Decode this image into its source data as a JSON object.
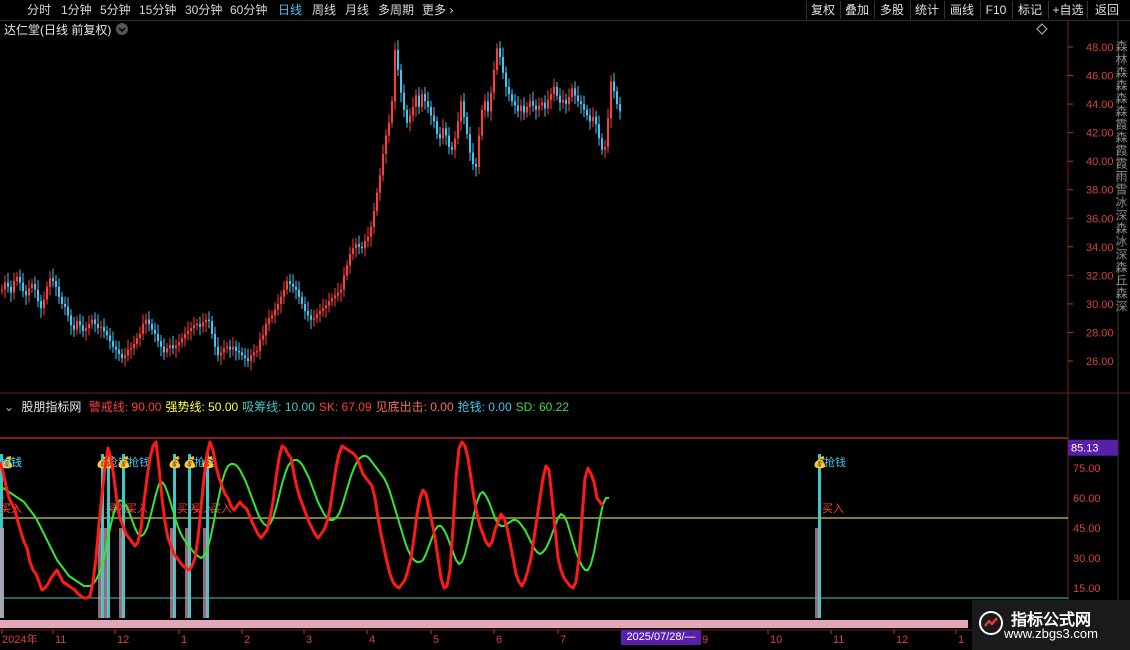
{
  "topbar": {
    "periods": [
      "分时",
      "1分钟",
      "5分钟",
      "15分钟",
      "30分钟",
      "60分钟",
      "日线",
      "周线",
      "月线",
      "多周期",
      "更多"
    ],
    "active_index": 6,
    "right_buttons": [
      "复权",
      "叠加",
      "多股",
      "统计",
      "画线",
      "F10",
      "标记",
      "+自选",
      "返回"
    ]
  },
  "chart_title": "达仁堂(日线 前复权)",
  "price_axis": [
    "48.00",
    "46.00",
    "44.00",
    "42.00",
    "40.00",
    "38.00",
    "36.00",
    "34.00",
    "32.00",
    "30.00",
    "28.00",
    "26.00"
  ],
  "indicator": {
    "name": "股朋指标网",
    "params": [
      {
        "label": "警戒线: 90.00",
        "color": "#ff3b3b"
      },
      {
        "label": "强势线: 50.00",
        "color": "#ffff40"
      },
      {
        "label": "吸筹线: 10.00",
        "color": "#3fc6c6"
      },
      {
        "label": "SK: 67.09",
        "color": "#ff3b3b"
      },
      {
        "label": "见底出击: 0.00",
        "color": "#ff6a6a"
      },
      {
        "label": "抢钱: 0.00",
        "color": "#3fc6f4"
      },
      {
        "label": "SD: 60.22",
        "color": "#3fdc3f"
      }
    ],
    "axis": [
      "75.00",
      "60.00",
      "45.00",
      "30.00",
      "15.00"
    ],
    "current_value": "85.13",
    "signal_label": "抢钱",
    "buy_label": "买入"
  },
  "x_axis": [
    "2024年",
    "11",
    "12",
    "1",
    "2",
    "3",
    "4",
    "5",
    "6",
    "7",
    "9",
    "10",
    "11",
    "12",
    "1"
  ],
  "date_badge": "2025/07/28/—",
  "right_strip_text": "森林森森森森霞森霞霞雨雪冰深森冰深森丘森深",
  "brand": {
    "name": "指标公式网",
    "url": "www.zbgs3.com"
  },
  "colors": {
    "up": "#ff3b3b",
    "down": "#3fc6f4",
    "sk": "#ff1a1a",
    "sd": "#33e633"
  },
  "chart_data": {
    "type": "line",
    "x": [
      0,
      3,
      6,
      9,
      12,
      15,
      18,
      21,
      24,
      27,
      30,
      33,
      36,
      39,
      42,
      45,
      48,
      51,
      54,
      57,
      60,
      63,
      66,
      69,
      72,
      75,
      78,
      81,
      84,
      87,
      90,
      93,
      96,
      99,
      102,
      105,
      108,
      111,
      114,
      117,
      120,
      123,
      126,
      129,
      132,
      135,
      138,
      141,
      144,
      147,
      150,
      153,
      156,
      159,
      162,
      165,
      168,
      171,
      174,
      177,
      180,
      183,
      186,
      189,
      192,
      195,
      198,
      201,
      204,
      207,
      210,
      213,
      216,
      219,
      222,
      225,
      228,
      231,
      234,
      237,
      240,
      243,
      246,
      249,
      252,
      255,
      258,
      261,
      264,
      267,
      270,
      273,
      276,
      279,
      282,
      285,
      288,
      291,
      294,
      297,
      300,
      303,
      306,
      309,
      312,
      315,
      318,
      321,
      324,
      327,
      330,
      333,
      336,
      339,
      342,
      345,
      348,
      351,
      354,
      357,
      360,
      363,
      366,
      369,
      372,
      375,
      378,
      381,
      384,
      387,
      390,
      393,
      396,
      399,
      402,
      405,
      408,
      411,
      414,
      417,
      420,
      423,
      426,
      429,
      432,
      435,
      438,
      441,
      444,
      447,
      450,
      453,
      456,
      459,
      462,
      465,
      468,
      471,
      474,
      477,
      480,
      483,
      486,
      489,
      492,
      495,
      498,
      501,
      504,
      507,
      510,
      513,
      516,
      519,
      522,
      525,
      528,
      531,
      534,
      537,
      540,
      543,
      546,
      549,
      552,
      555,
      558,
      561,
      564,
      567,
      570,
      573,
      576,
      579,
      582,
      585,
      588,
      591,
      594,
      597,
      600,
      603,
      606,
      609,
      612,
      615,
      618,
      621,
      624,
      627,
      630,
      633,
      636,
      639,
      642,
      645,
      648,
      651,
      654,
      657,
      660,
      663,
      666,
      669,
      672,
      675,
      678,
      681,
      684,
      687,
      690,
      693,
      696,
      699,
      702,
      705,
      708,
      711,
      714,
      717,
      720,
      723,
      726,
      729,
      732,
      735,
      738,
      741,
      744,
      747,
      750,
      753,
      756,
      759,
      762,
      765,
      768,
      771,
      774,
      777,
      780,
      783,
      786,
      789,
      792,
      795,
      798,
      801,
      804,
      807,
      810,
      813,
      816,
      819,
      822,
      825,
      828,
      831,
      834,
      837,
      840,
      843,
      846,
      849,
      852,
      855,
      858,
      861,
      864,
      867,
      870,
      873,
      876,
      879,
      882,
      885,
      888,
      891,
      894,
      897,
      900,
      903,
      906,
      909,
      912,
      915,
      918,
      921,
      924,
      927,
      930,
      933,
      936,
      939,
      942,
      945,
      948,
      951,
      954,
      957,
      960,
      963,
      966,
      969
    ],
    "series": [
      {
        "values": [
          31.0,
          31.5,
          31.2,
          30.8,
          31.6,
          31.9,
          31.5,
          30.9,
          30.6,
          31.1,
          31.4,
          31.0,
          30.2,
          29.7,
          30.3,
          31.2,
          31.8,
          31.6,
          31.2,
          30.5,
          30.0,
          29.8,
          29.2,
          28.5,
          28.2,
          28.8,
          28.5,
          28.1,
          28.3,
          28.6,
          28.9,
          28.6,
          28.3,
          28.4,
          28.1,
          27.8,
          27.4,
          27.0,
          26.8,
          26.5,
          26.2,
          26.4,
          26.8,
          26.9,
          27.2,
          27.6,
          27.9,
          28.6,
          28.9,
          28.6,
          28.2,
          27.9,
          27.4,
          27.0,
          26.6,
          26.9,
          27.1,
          26.9,
          27.1,
          27.3,
          27.6,
          27.9,
          28.1,
          28.3,
          28.5,
          28.6,
          28.4,
          28.7,
          28.9,
          28.8,
          27.9,
          27.0,
          26.4,
          26.6,
          26.9,
          27.0,
          26.8,
          27.0,
          26.7,
          26.6,
          26.4,
          26.2,
          26.0,
          26.4,
          26.6,
          26.7,
          27.5,
          27.8,
          28.6,
          29.0,
          29.2,
          29.6,
          30.0,
          30.5,
          31.0,
          31.6,
          31.4,
          31.2,
          31.0,
          30.5,
          30.0,
          29.5,
          29.2,
          28.9,
          29.0,
          29.3,
          29.5,
          29.7,
          29.9,
          30.2,
          30.4,
          30.6,
          30.8,
          31.0,
          32.0,
          32.7,
          33.5,
          33.9,
          34.2,
          34.0,
          33.9,
          34.4,
          34.7,
          35.4,
          36.5,
          37.8,
          39.0,
          40.5,
          41.8,
          42.7,
          44.2,
          47.8,
          46.4,
          44.8,
          43.6,
          42.7,
          43.2,
          43.8,
          44.6,
          43.8,
          44.7,
          44.2,
          43.8,
          43.2,
          42.8,
          41.9,
          41.6,
          42.3,
          41.8,
          41.0,
          40.8,
          41.6,
          42.8,
          44.2,
          43.1,
          41.9,
          40.6,
          39.8,
          39.6,
          41.8,
          43.6,
          44.2,
          43.5,
          44.8,
          46.4,
          47.9,
          47.3,
          46.2,
          45.2,
          44.7,
          44.2,
          43.9,
          43.5,
          43.9,
          43.4,
          43.8,
          44.2,
          43.9,
          43.6,
          43.9,
          44.1,
          43.7,
          44.3,
          44.7,
          45.2,
          44.6,
          44.1,
          44.3,
          44.0,
          44.5,
          45.1,
          44.6,
          44.2,
          44.0,
          43.6,
          43.2,
          42.8,
          43.1,
          42.6,
          41.6,
          40.8,
          41.0,
          43.0,
          45.6,
          44.9,
          44.0,
          43.5
        ]
      },
      {
        "name": "SK",
        "values": [
          78,
          73,
          66,
          60,
          57,
          54,
          48,
          43,
          38,
          35,
          28,
          24,
          22,
          18,
          14,
          15,
          17,
          20,
          22,
          24,
          21,
          18,
          17,
          16,
          15,
          14,
          12,
          11,
          10,
          10,
          11,
          18,
          30,
          47,
          62,
          75,
          85,
          80,
          70,
          58,
          50,
          46,
          42,
          40,
          38,
          36,
          38,
          45,
          58,
          70,
          80,
          86,
          88,
          75,
          60,
          48,
          40,
          36,
          32,
          30,
          28,
          26,
          25,
          24,
          26,
          30,
          40,
          55,
          70,
          82,
          88,
          84,
          76,
          70,
          66,
          62,
          60,
          56,
          54,
          56,
          58,
          56,
          55,
          52,
          48,
          45,
          42,
          40,
          42,
          44,
          50,
          58,
          70,
          80,
          86,
          85,
          82,
          80,
          72,
          65,
          60,
          56,
          52,
          48,
          45,
          42,
          40,
          42,
          44,
          48,
          55,
          65,
          75,
          82,
          86,
          85,
          84,
          83,
          82,
          80,
          76,
          72,
          70,
          68,
          66,
          60,
          50,
          42,
          35,
          28,
          22,
          18,
          16,
          15,
          17,
          19,
          24,
          30,
          40,
          52,
          60,
          64,
          62,
          55,
          48,
          40,
          30,
          20,
          15,
          16,
          24,
          45,
          70,
          85,
          88,
          86,
          80,
          70,
          60,
          52,
          46,
          42,
          38,
          36,
          38,
          44,
          48,
          52,
          50,
          45,
          38,
          30,
          22,
          18,
          16,
          19,
          24,
          30,
          40,
          50,
          60,
          70,
          76,
          74,
          60,
          45,
          30,
          24,
          20,
          18,
          16,
          15,
          18,
          30,
          50,
          70,
          75,
          72,
          68,
          60,
          58,
          56
        ]
      },
      {
        "name": "SD",
        "values": [
          66,
          65,
          64,
          63,
          62,
          61,
          60,
          59,
          58,
          56,
          54,
          52,
          50,
          47,
          44,
          41,
          38,
          35,
          32,
          29,
          27,
          25,
          23,
          21,
          20,
          19,
          18,
          17,
          16,
          16,
          16,
          17,
          19,
          22,
          26,
          32,
          40,
          47,
          53,
          57,
          59,
          58,
          56,
          53,
          49,
          45,
          42,
          41,
          42,
          45,
          50,
          56,
          62,
          67,
          68,
          66,
          62,
          57,
          52,
          47,
          43,
          40,
          38,
          36,
          34,
          32,
          31,
          30,
          31,
          34,
          39,
          46,
          54,
          61,
          68,
          73,
          76,
          77,
          77,
          76,
          74,
          71,
          68,
          64,
          60,
          56,
          52,
          49,
          47,
          46,
          47,
          50,
          55,
          61,
          67,
          72,
          76,
          78,
          79,
          79,
          78,
          76,
          73,
          70,
          66,
          62,
          58,
          55,
          52,
          50,
          49,
          49,
          50,
          52,
          56,
          61,
          66,
          71,
          75,
          78,
          80,
          81,
          81,
          80,
          78,
          76,
          74,
          72,
          70,
          67,
          63,
          58,
          53,
          48,
          43,
          38,
          34,
          31,
          29,
          28,
          28,
          29,
          32,
          36,
          40,
          44,
          46,
          46,
          44,
          41,
          37,
          33,
          29,
          27,
          28,
          32,
          38,
          45,
          52,
          58,
          62,
          63,
          61,
          58,
          54,
          50,
          47,
          46,
          46,
          47,
          48,
          49,
          49,
          48,
          46,
          44,
          41,
          38,
          35,
          33,
          32,
          33,
          35,
          38,
          42,
          46,
          50,
          52,
          51,
          48,
          43,
          38,
          33,
          29,
          26,
          24,
          24,
          27,
          33,
          41,
          50,
          57,
          60,
          60
        ]
      }
    ]
  }
}
